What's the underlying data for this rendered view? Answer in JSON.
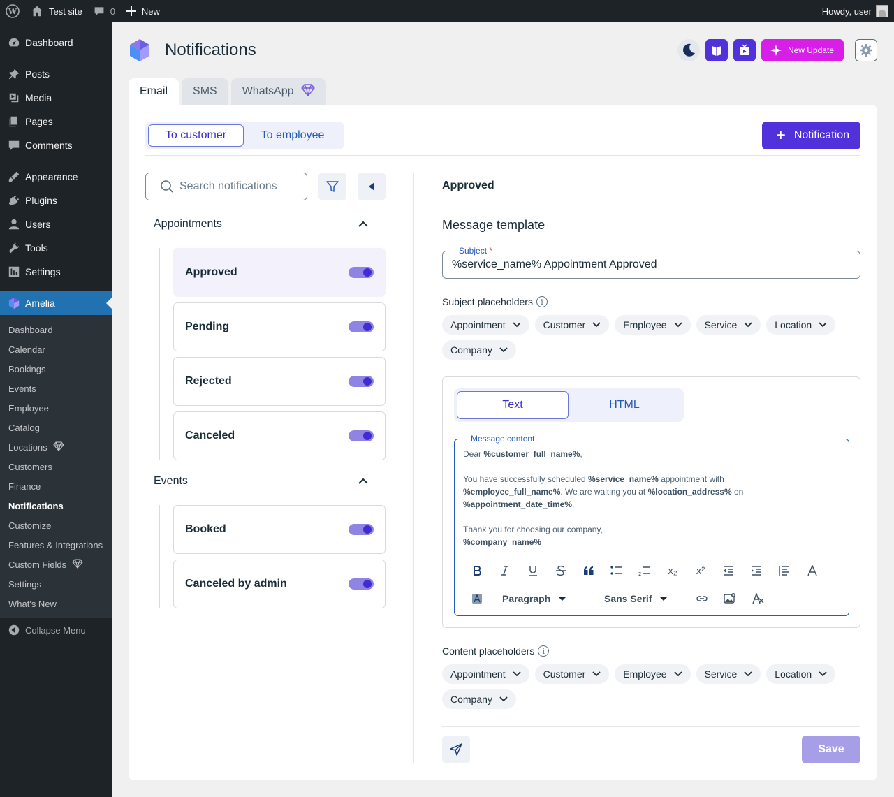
{
  "adminbar": {
    "site_name": "Test site",
    "comments_count": "0",
    "new_label": "New",
    "greeting": "Howdy, user"
  },
  "sidebar": {
    "items": [
      {
        "label": "Dashboard",
        "icon": "dashboard-icon"
      },
      {
        "label": "Posts",
        "icon": "pin-icon"
      },
      {
        "label": "Media",
        "icon": "media-icon"
      },
      {
        "label": "Pages",
        "icon": "pages-icon"
      },
      {
        "label": "Comments",
        "icon": "comment-icon"
      },
      {
        "label": "Appearance",
        "icon": "brush-icon"
      },
      {
        "label": "Plugins",
        "icon": "plug-icon"
      },
      {
        "label": "Users",
        "icon": "user-icon"
      },
      {
        "label": "Tools",
        "icon": "wrench-icon"
      },
      {
        "label": "Settings",
        "icon": "settings-icon"
      },
      {
        "label": "Amelia",
        "icon": "amelia-icon"
      }
    ],
    "submenu": [
      "Dashboard",
      "Calendar",
      "Bookings",
      "Events",
      "Employee",
      "Catalog",
      "Locations",
      "Customers",
      "Finance",
      "Notifications",
      "Customize",
      "Features & Integrations",
      "Custom Fields",
      "Settings",
      "What's New"
    ],
    "collapse_label": "Collapse Menu"
  },
  "header": {
    "title": "Notifications",
    "new_update_label": "New Update"
  },
  "tabs": [
    "Email",
    "SMS",
    "WhatsApp"
  ],
  "audience": {
    "customer": "To customer",
    "employee": "To employee"
  },
  "add_button": "Notification",
  "search": {
    "placeholder": "Search notifications"
  },
  "groups": [
    {
      "title": "Appointments",
      "items": [
        "Approved",
        "Pending",
        "Rejected",
        "Canceled"
      ]
    },
    {
      "title": "Events",
      "items": [
        "Booked",
        "Canceled by admin"
      ]
    }
  ],
  "detail": {
    "name": "Approved",
    "section_title": "Message template",
    "subject_label": "Subject",
    "subject_required": "*",
    "subject_value": "%service_name% Appointment Approved",
    "subject_placeholders_label": "Subject placeholders",
    "content_placeholders_label": "Content placeholders",
    "placeholder_chips": [
      "Appointment",
      "Customer",
      "Employee",
      "Service",
      "Location",
      "Company"
    ],
    "editor_modes": [
      "Text",
      "HTML"
    ],
    "content_label": "Message content",
    "content": {
      "line1_a": "Dear ",
      "line1_b": "%customer_full_name%",
      "line1_c": ",",
      "line2_a": "You have successfully scheduled ",
      "line2_b": "%service_name%",
      "line2_c": " appointment with",
      "line3_a": "%employee_full_name%",
      "line3_b": ". We are waiting you at ",
      "line3_c": "%location_address%",
      "line3_d": " on",
      "line4_a": "%appointment_date_time%",
      "line4_b": ".",
      "line5": "Thank you for choosing our company,",
      "line6": "%company_name%"
    },
    "toolbar": {
      "paragraph": "Paragraph",
      "font": "Sans Serif",
      "subscript": "x₂",
      "superscript": "x²"
    },
    "save_label": "Save"
  },
  "colors": {
    "accent": "#5131da",
    "new_update": "#d81fe8",
    "wp_blue": "#2271b1"
  }
}
